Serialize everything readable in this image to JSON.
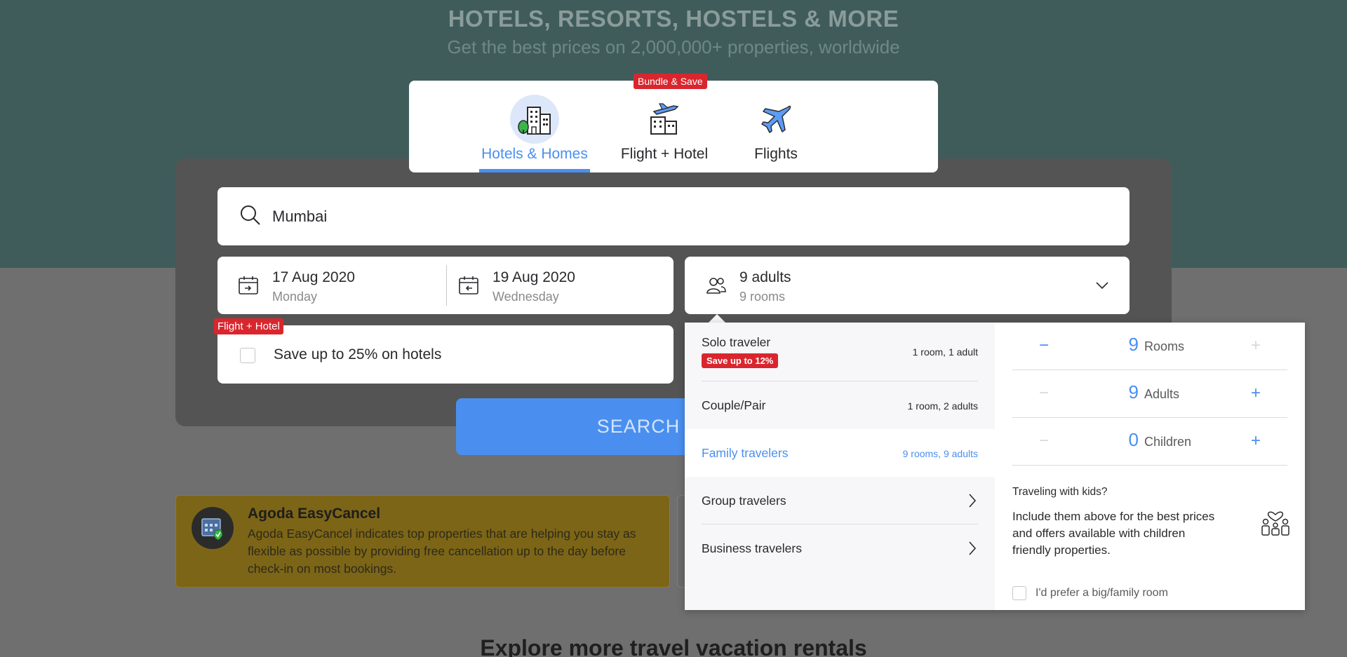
{
  "hero": {
    "title": "HOTELS, RESORTS, HOSTELS & MORE",
    "subtitle": "Get the best prices on 2,000,000+ properties, worldwide"
  },
  "tabs": [
    {
      "label": "Hotels & Homes",
      "icon": "hotel-building-icon",
      "active": true
    },
    {
      "label": "Flight + Hotel",
      "icon": "flight-hotel-icon",
      "active": false
    },
    {
      "label": "Flights",
      "icon": "airplane-icon",
      "active": false
    }
  ],
  "bundle_badge": "Bundle & Save",
  "search": {
    "destination": "Mumbai",
    "checkin": {
      "date": "17 Aug 2020",
      "day": "Monday"
    },
    "checkout": {
      "date": "19 Aug 2020",
      "day": "Wednesday"
    },
    "occupancy": {
      "main": "9 adults",
      "sub": "9 rooms"
    },
    "promo_badge": "Flight + Hotel",
    "promo_text": "Save up to 25% on hotels",
    "button_label": "SEARCH"
  },
  "info_card": {
    "title": "Agoda EasyCancel",
    "body": "Agoda EasyCancel indicates top properties that are helping you stay as flexible as possible by providing free cancellation up to the day before check-in on most bookings."
  },
  "explore_title": "Explore more travel vacation rentals",
  "traveler_types": [
    {
      "name": "Solo traveler",
      "info": "1 room, 1 adult",
      "badge": "Save up to 12%"
    },
    {
      "name": "Couple/Pair",
      "info": "1 room, 2 adults"
    },
    {
      "name": "Family travelers",
      "info": "9 rooms, 9 adults",
      "selected": true
    },
    {
      "name": "Group travelers",
      "info": ""
    },
    {
      "name": "Business travelers",
      "info": ""
    }
  ],
  "counters": [
    {
      "value": "9",
      "label": "Rooms",
      "minus_enabled": true,
      "plus_enabled": false
    },
    {
      "value": "9",
      "label": "Adults",
      "minus_enabled": false,
      "plus_enabled": true
    },
    {
      "value": "0",
      "label": "Children",
      "minus_enabled": false,
      "plus_enabled": true
    }
  ],
  "kids": {
    "question": "Traveling with kids?",
    "info": "Include them above for the best prices and offers available with children friendly properties.",
    "checkbox_label": "I'd prefer a big/family room"
  },
  "colors": {
    "accent": "#4a8ff0",
    "badge": "#d9262e",
    "hero": "#3f5c5b",
    "info_card": "#7c6517"
  }
}
